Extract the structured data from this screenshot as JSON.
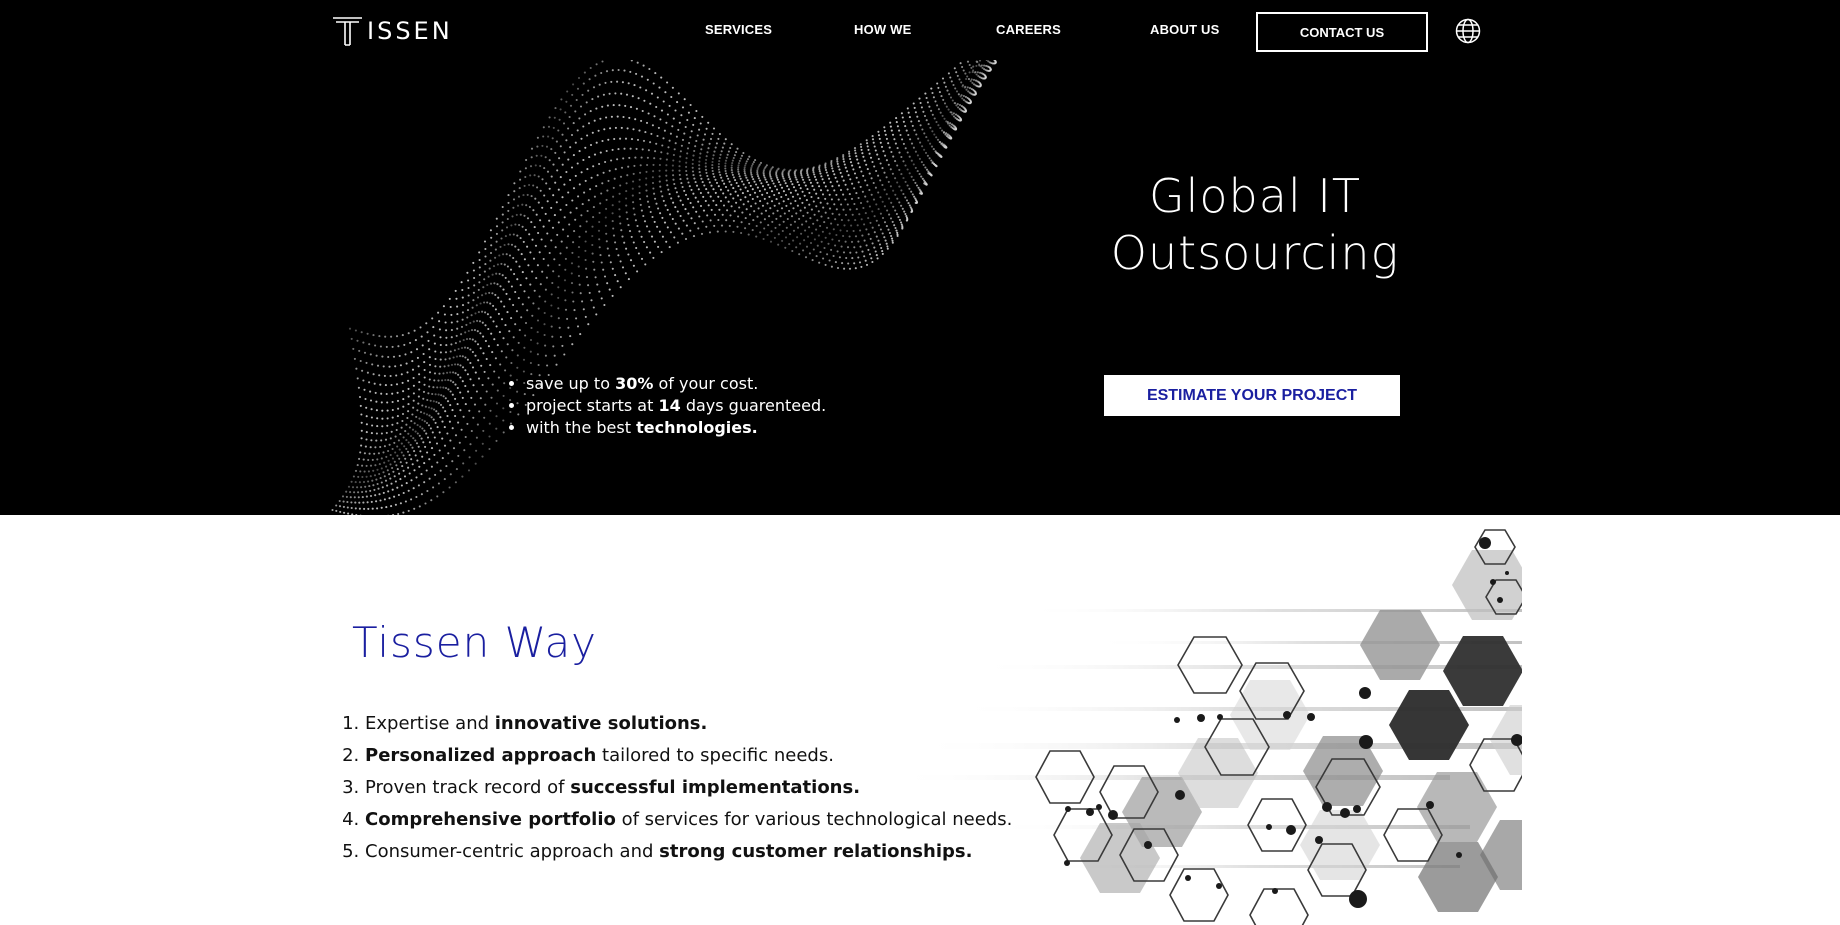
{
  "header": {
    "logo_text": "ISSEN",
    "nav": [
      "SERVICES",
      "HOW WE",
      "CAREERS",
      "ABOUT US"
    ],
    "contact_label": "CONTACT US",
    "language_icon": "globe-icon"
  },
  "hero": {
    "title_line1": "Global IT",
    "title_line2": "Outsourcing",
    "cta_label": "ESTIMATE YOUR PROJECT",
    "benefits": [
      {
        "pre": "save up to ",
        "bold": "30%",
        "post": " of your cost."
      },
      {
        "pre": "project starts at ",
        "bold": "14",
        "post": " days guarenteed."
      },
      {
        "pre": "with the best ",
        "bold": "technologies.",
        "post": ""
      }
    ]
  },
  "way": {
    "title": "Tissen Way",
    "items": [
      {
        "a": "Expertise and ",
        "b": "innovative solutions.",
        "c": ""
      },
      {
        "a": "",
        "b": "Personalized approach",
        "c": " tailored to specific needs."
      },
      {
        "a": "Proven track record of ",
        "b": "successful implementations.",
        "c": ""
      },
      {
        "a": "",
        "b": "Comprehensive portfolio",
        "c": " of services for various technological needs."
      },
      {
        "a": "Consumer-centric approach and ",
        "b": "strong customer relationships.",
        "c": ""
      }
    ]
  },
  "colors": {
    "brand_blue": "#1a1fa0",
    "hero_bg": "#000000",
    "page_bg": "#ffffff"
  }
}
